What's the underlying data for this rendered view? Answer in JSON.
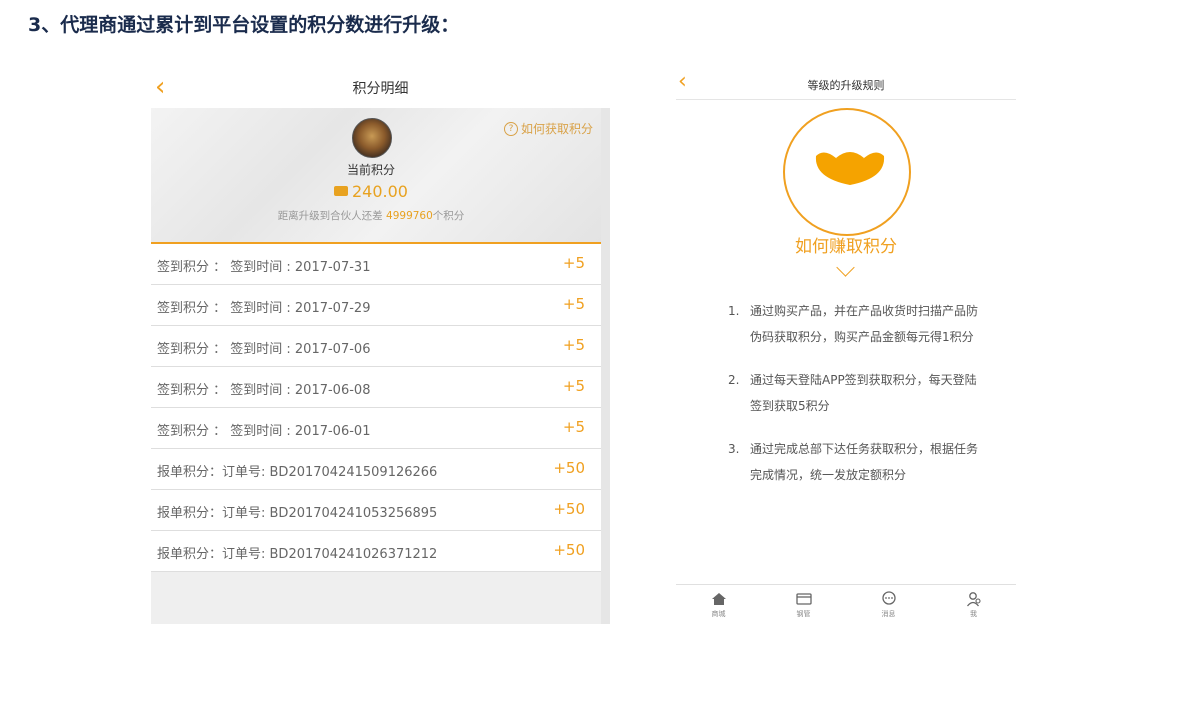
{
  "heading": "3、代理商通过累计到平台设置的积分数进行升级：",
  "left": {
    "title": "积分明细",
    "help_link": "如何获取积分",
    "current_label": "当前积分",
    "current_value": "240.00",
    "upgrade_prefix": "距离升级到合伙人还差",
    "upgrade_points": "4999760",
    "upgrade_suffix": "个积分",
    "records": [
      {
        "label": "签到积分 ： 签到时间 : 2017-07-31",
        "points": "+5"
      },
      {
        "label": "签到积分 ： 签到时间 : 2017-07-29",
        "points": "+5"
      },
      {
        "label": "签到积分 ： 签到时间 : 2017-07-06",
        "points": "+5"
      },
      {
        "label": "签到积分 ： 签到时间 : 2017-06-08",
        "points": "+5"
      },
      {
        "label": "签到积分 ： 签到时间 : 2017-06-01",
        "points": "+5"
      },
      {
        "label": "报单积分：订单号: BD201704241509126266",
        "points": "+50"
      },
      {
        "label": "报单积分：订单号: BD201704241053256895",
        "points": "+50"
      },
      {
        "label": "报单积分：订单号: BD201704241026371212",
        "points": "+50"
      }
    ]
  },
  "right": {
    "title": "等级的升级规则",
    "earn_title": "如何赚取积分",
    "rules": [
      {
        "num": "1.",
        "text": "通过购买产品，并在产品收货时扫描产品防伪码获取积分，购买产品金额每元得1积分"
      },
      {
        "num": "2.",
        "text": "通过每天登陆APP签到获取积分，每天登陆签到获取5积分"
      },
      {
        "num": "3.",
        "text": "通过完成总部下达任务获取积分，根据任务完成情况，统一发放定额积分"
      }
    ],
    "tabs": [
      {
        "label": "商城",
        "icon": "home-icon"
      },
      {
        "label": "钢管",
        "icon": "card-icon"
      },
      {
        "label": "消息",
        "icon": "chat-icon"
      },
      {
        "label": "我",
        "icon": "user-icon"
      }
    ]
  },
  "colors": {
    "accent": "#f0a020",
    "heading": "#1a2b4c"
  }
}
